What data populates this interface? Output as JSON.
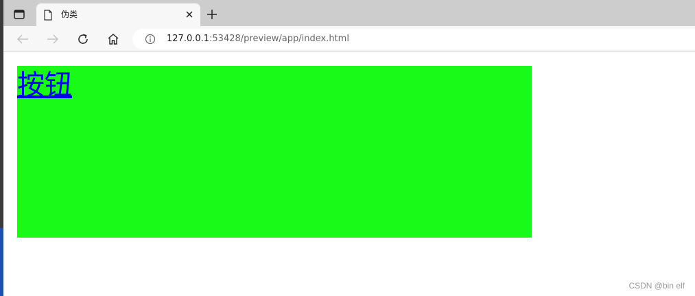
{
  "browser": {
    "tab": {
      "title": "伪类",
      "favicon_icon": "document-icon",
      "close_icon": "close-icon"
    },
    "new_tab_icon": "plus-icon",
    "tab_actions_icon": "tab-actions-icon",
    "nav": {
      "back_icon": "back-arrow-icon",
      "forward_icon": "forward-arrow-icon",
      "reload_icon": "reload-icon",
      "home_icon": "home-icon"
    },
    "address": {
      "info_icon": "info-icon",
      "url_host": "127.0.0.1",
      "url_rest": ":53428/preview/app/index.html"
    }
  },
  "page": {
    "link_label": "按钮",
    "box_color": "#19fa18",
    "link_color": "#0000ee"
  },
  "watermark": "CSDN @bin elf"
}
